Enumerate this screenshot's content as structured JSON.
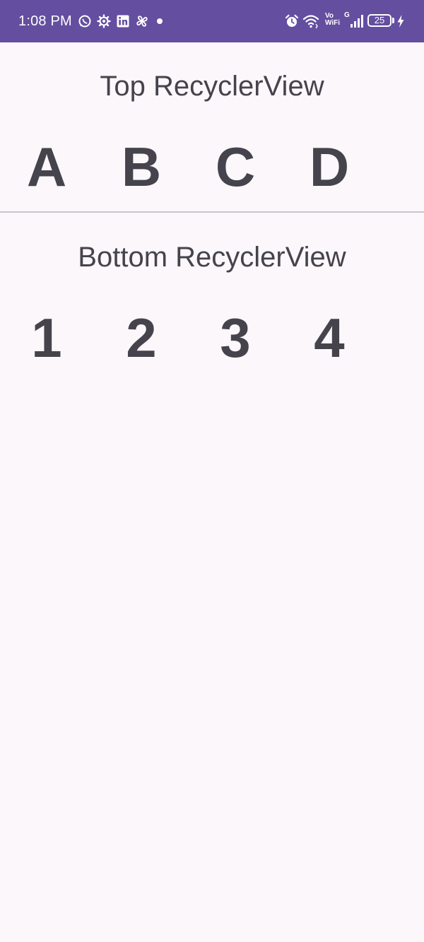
{
  "status_bar": {
    "time": "1:08 PM",
    "vowifi_top": "Vo",
    "vowifi_bottom": "WiFi",
    "network": "G",
    "battery": "25",
    "icons": [
      "whatsapp-icon",
      "settings-gear-icon",
      "linkedin-icon",
      "pinwheel-icon",
      "notification-dot",
      "alarm-icon",
      "wifi-icon",
      "signal-icon",
      "battery-icon",
      "charging-bolt-icon"
    ],
    "color": "#644ea0"
  },
  "top_list": {
    "title": "Top RecyclerView",
    "items": [
      "A",
      "B",
      "C",
      "D"
    ]
  },
  "bottom_list": {
    "title": "Bottom RecyclerView",
    "items": [
      "1",
      "2",
      "3",
      "4"
    ]
  },
  "colors": {
    "background": "#fcf7fb",
    "text": "#45434b",
    "divider": "#c9c5cc"
  }
}
